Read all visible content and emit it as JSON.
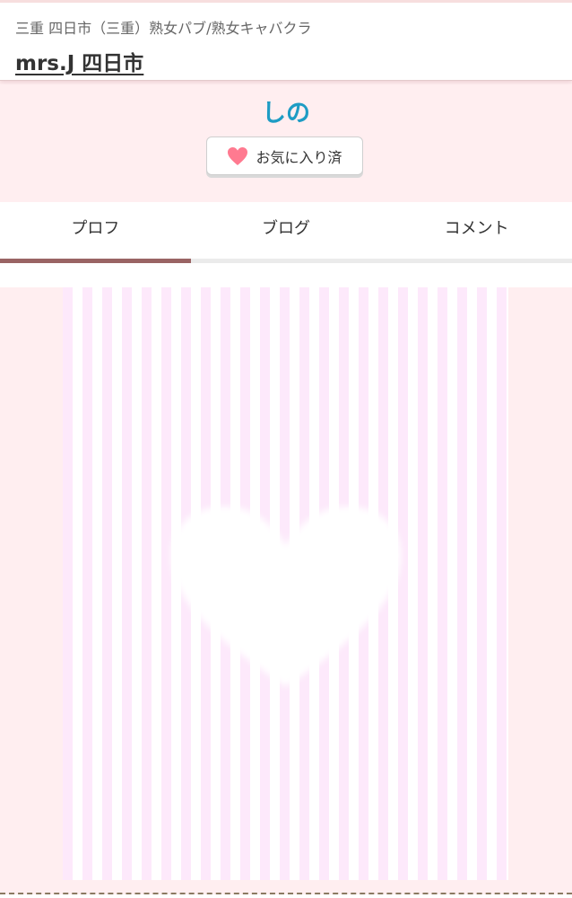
{
  "header": {
    "category": "三重 四日市（三重）熟女パブ/熟女キャバクラ",
    "shop_name": "mrs.J 四日市"
  },
  "profile": {
    "name": "しの",
    "favorite_button": {
      "label": "お気に入り済",
      "icon": "heart-icon",
      "state": "favorited"
    }
  },
  "tabs": [
    {
      "label": "プロフ",
      "active": true
    },
    {
      "label": "ブログ",
      "active": false
    },
    {
      "label": "コメント",
      "active": false
    }
  ],
  "photo": {
    "placeholder": "heart-placeholder-image"
  },
  "colors": {
    "accent_name": "#1e9cc4",
    "active_tab": "#9a6464",
    "heart": "#ff7a90",
    "background": "#ffeef0"
  }
}
